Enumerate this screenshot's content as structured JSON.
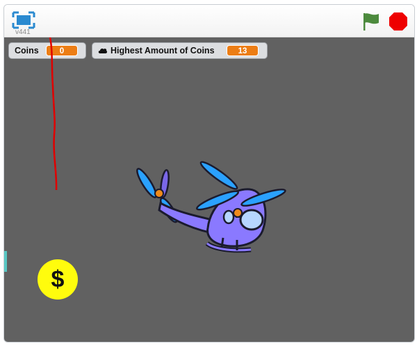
{
  "header": {
    "version": "v441",
    "fullscreen_icon": "fullscreen-icon",
    "flag_icon": "green-flag-icon",
    "stop_icon": "stop-sign-icon",
    "flag_color": "#4c8a3d",
    "stop_color": "#ee0000"
  },
  "monitors": {
    "coins": {
      "label": "Coins",
      "value": "0"
    },
    "highest": {
      "label": "Highest Amount of Coins",
      "value": "13",
      "icon": "cloud-icon"
    }
  },
  "stage": {
    "background": "#616161",
    "coin_symbol": "$",
    "sprites": [
      "helicopter",
      "coin",
      "laser"
    ]
  }
}
